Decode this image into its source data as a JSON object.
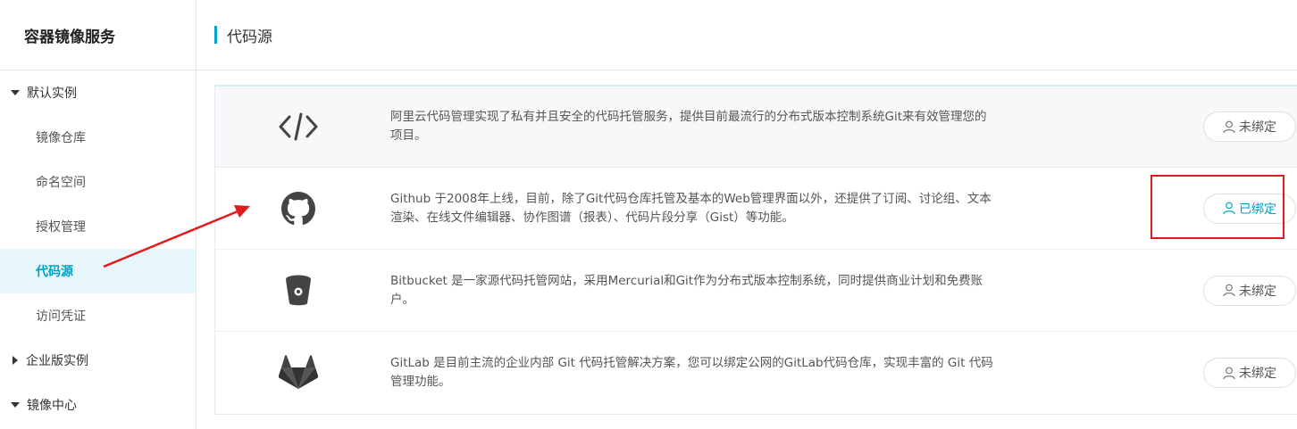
{
  "sidebar": {
    "title": "容器镜像服务",
    "groups": [
      {
        "label": "默认实例",
        "expanded": true,
        "items": [
          "镜像仓库",
          "命名空间",
          "授权管理",
          "代码源",
          "访问凭证"
        ],
        "active": "代码源"
      },
      {
        "label": "企业版实例",
        "expanded": false
      },
      {
        "label": "镜像中心",
        "expanded": true
      }
    ]
  },
  "header": {
    "title": "代码源"
  },
  "sources": [
    {
      "icon": "code-icon",
      "description": "阿里云代码管理实现了私有并且安全的代码托管服务，提供目前最流行的分布式版本控制系统Git来有效管理您的项目。",
      "status": "未绑定"
    },
    {
      "icon": "github-icon",
      "description": "Github 于2008年上线，目前，除了Git代码仓库托管及基本的Web管理界面以外，还提供了订阅、讨论组、文本渲染、在线文件编辑器、协作图谱（报表）、代码片段分享（Gist）等功能。",
      "status": "已绑定"
    },
    {
      "icon": "bitbucket-icon",
      "description": "Bitbucket 是一家源代码托管网站，采用Mercurial和Git作为分布式版本控制系统，同时提供商业计划和免费账户。",
      "status": "未绑定"
    },
    {
      "icon": "gitlab-icon",
      "description": "GitLab 是目前主流的企业内部 Git 代码托管解决方案，您可以绑定公网的GitLab代码仓库，实现丰富的 Git 代码管理功能。",
      "status": "未绑定"
    }
  ],
  "colors": {
    "accent": "#00a2ca",
    "annotation": "#e01b1b"
  }
}
